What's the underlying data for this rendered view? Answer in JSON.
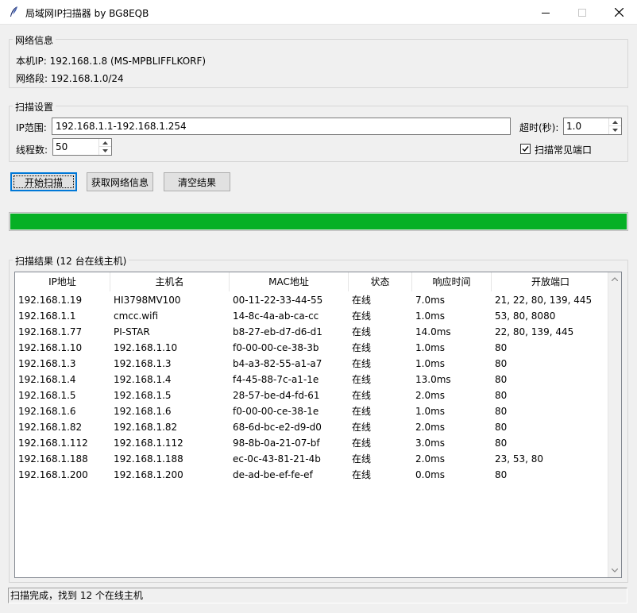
{
  "window": {
    "title": "局域网IP扫描器 by BG8EQB"
  },
  "network_info": {
    "group_label": "网络信息",
    "local_ip_text": "本机IP: 192.168.1.8 (MS-MPBLIFFLKORF)",
    "segment_text": "网络段: 192.168.1.0/24"
  },
  "scan_settings": {
    "group_label": "扫描设置",
    "ip_range_label": "IP范围:",
    "ip_range_value": "192.168.1.1-192.168.1.254",
    "timeout_label": "超时(秒):",
    "timeout_value": "1.0",
    "threads_label": "线程数:",
    "threads_value": "50",
    "scan_common_ports_label": "扫描常见端口",
    "scan_common_ports_checked": true
  },
  "buttons": {
    "start_scan": "开始扫描",
    "get_network_info": "获取网络信息",
    "clear_results": "清空结果"
  },
  "progress": {
    "value_percent": 100,
    "color": "#06b025"
  },
  "results": {
    "group_label": "扫描结果 (12 台在线主机)",
    "columns": [
      "IP地址",
      "主机名",
      "MAC地址",
      "状态",
      "响应时间",
      "开放端口"
    ],
    "rows": [
      [
        "192.168.1.19",
        "HI3798MV100",
        "00-11-22-33-44-55",
        "在线",
        "7.0ms",
        "21, 22, 80, 139, 445"
      ],
      [
        "192.168.1.1",
        "cmcc.wifi",
        "14-8c-4a-ab-ca-cc",
        "在线",
        "1.0ms",
        "53, 80, 8080"
      ],
      [
        "192.168.1.77",
        "PI-STAR",
        "b8-27-eb-d7-d6-d1",
        "在线",
        "14.0ms",
        "22, 80, 139, 445"
      ],
      [
        "192.168.1.10",
        "192.168.1.10",
        "f0-00-00-ce-38-3b",
        "在线",
        "1.0ms",
        "80"
      ],
      [
        "192.168.1.3",
        "192.168.1.3",
        "b4-a3-82-55-a1-a7",
        "在线",
        "1.0ms",
        "80"
      ],
      [
        "192.168.1.4",
        "192.168.1.4",
        "f4-45-88-7c-a1-1e",
        "在线",
        "13.0ms",
        "80"
      ],
      [
        "192.168.1.5",
        "192.168.1.5",
        "28-57-be-d4-fd-61",
        "在线",
        "2.0ms",
        "80"
      ],
      [
        "192.168.1.6",
        "192.168.1.6",
        "f0-00-00-ce-38-1e",
        "在线",
        "1.0ms",
        "80"
      ],
      [
        "192.168.1.82",
        "192.168.1.82",
        "68-6d-bc-e2-d9-d0",
        "在线",
        "2.0ms",
        "80"
      ],
      [
        "192.168.1.112",
        "192.168.1.112",
        "98-8b-0a-21-07-bf",
        "在线",
        "3.0ms",
        "80"
      ],
      [
        "192.168.1.188",
        "192.168.1.188",
        "ec-0c-43-81-21-4b",
        "在线",
        "2.0ms",
        "23, 53, 80"
      ],
      [
        "192.168.1.200",
        "192.168.1.200",
        "de-ad-be-ef-fe-ef",
        "在线",
        "0.0ms",
        "80"
      ]
    ]
  },
  "status_bar": {
    "text": "扫描完成，找到 12 个在线主机"
  },
  "icons": {
    "app": "feather-icon",
    "minimize": "minimize-icon",
    "maximize": "maximize-icon",
    "close": "close-icon"
  }
}
